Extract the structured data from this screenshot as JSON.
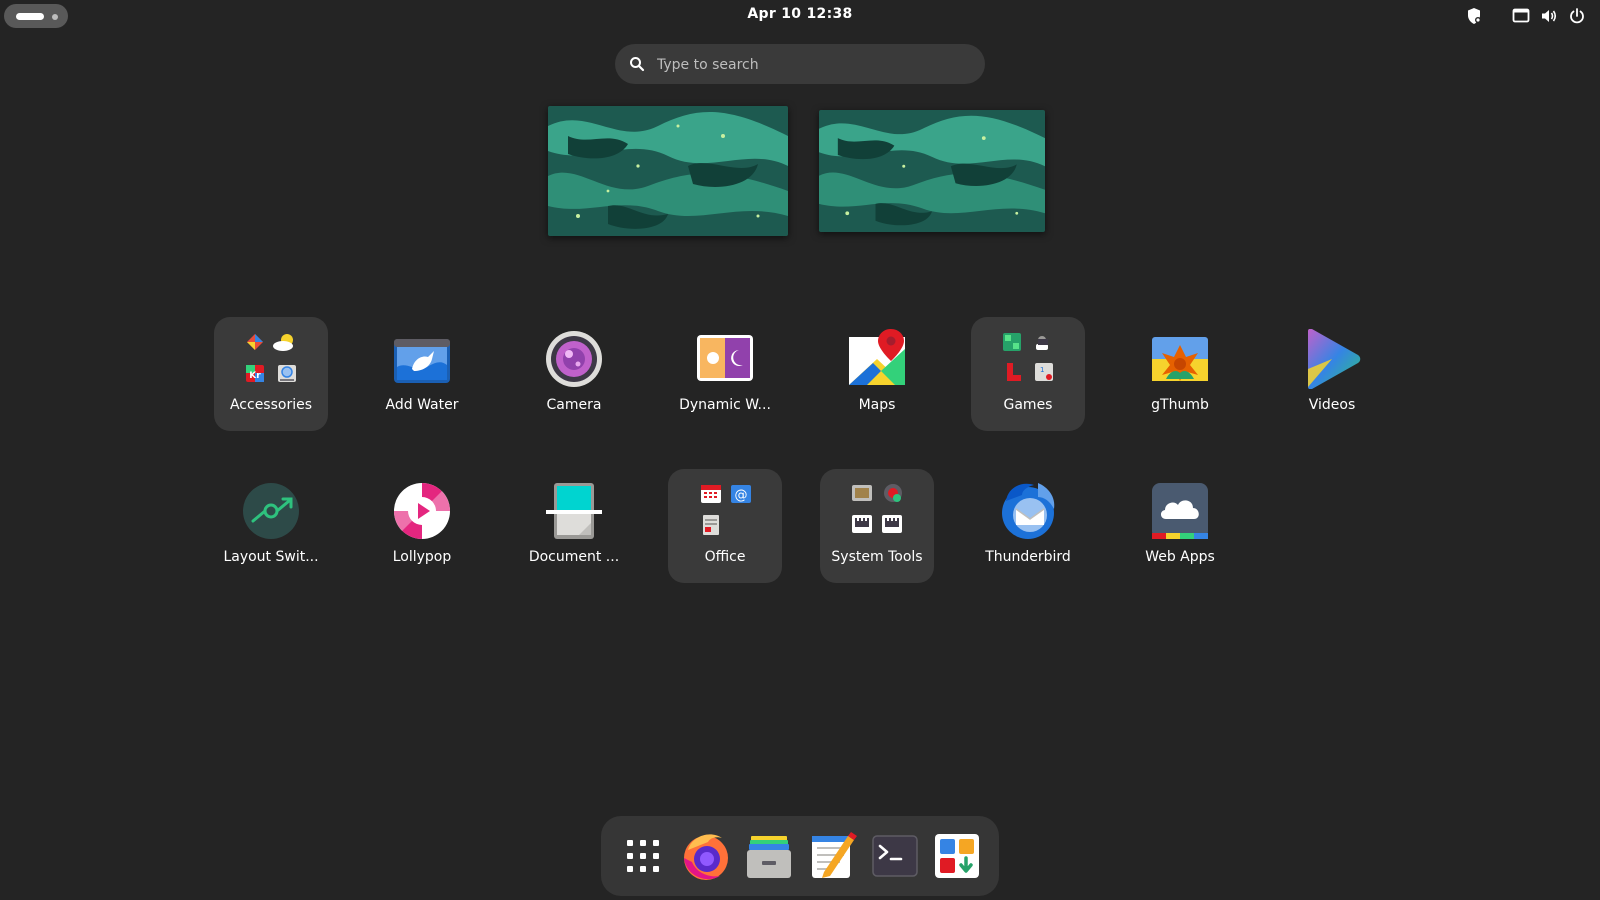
{
  "topbar": {
    "activities_icon": "activities-pill-indicator",
    "clock": "Apr 10  12:38",
    "tray_icons": [
      "privacy-shield-icon",
      "screen-share-icon",
      "volume-icon",
      "power-icon"
    ]
  },
  "search": {
    "placeholder": "Type to search",
    "icon": "search-icon"
  },
  "workspaces": [
    "workspace-1",
    "workspace-2"
  ],
  "apps": [
    {
      "label": "Accessories",
      "type": "folder",
      "icon": "accessories-folder-icon"
    },
    {
      "label": "Add Water",
      "type": "app",
      "icon": "add-water-icon"
    },
    {
      "label": "Camera",
      "type": "app",
      "icon": "camera-icon"
    },
    {
      "label": "Dynamic W...",
      "type": "app",
      "icon": "dynamic-wallpaper-icon"
    },
    {
      "label": "Maps",
      "type": "app",
      "icon": "maps-icon"
    },
    {
      "label": "Games",
      "type": "folder",
      "icon": "games-folder-icon"
    },
    {
      "label": "gThumb",
      "type": "app",
      "icon": "gthumb-icon"
    },
    {
      "label": "Videos",
      "type": "app",
      "icon": "videos-icon"
    },
    {
      "label": "Layout Swit...",
      "type": "app",
      "icon": "layout-switcher-icon"
    },
    {
      "label": "Lollypop",
      "type": "app",
      "icon": "lollypop-icon"
    },
    {
      "label": "Document ...",
      "type": "app",
      "icon": "document-scanner-icon"
    },
    {
      "label": "Office",
      "type": "folder",
      "icon": "office-folder-icon"
    },
    {
      "label": "System Tools",
      "type": "folder",
      "icon": "system-tools-folder-icon"
    },
    {
      "label": "Thunderbird",
      "type": "app",
      "icon": "thunderbird-icon"
    },
    {
      "label": "Web Apps",
      "type": "app",
      "icon": "web-apps-icon"
    }
  ],
  "dock": [
    "show-apps-grid-icon",
    "firefox-icon",
    "files-icon",
    "text-editor-icon",
    "terminal-icon",
    "software-store-icon"
  ],
  "colors": {
    "background": "#242424",
    "folder_bg": "#3a3a3a",
    "search_bg": "#3a3a3a",
    "dock_bg": "#363636",
    "text": "#ffffff"
  }
}
